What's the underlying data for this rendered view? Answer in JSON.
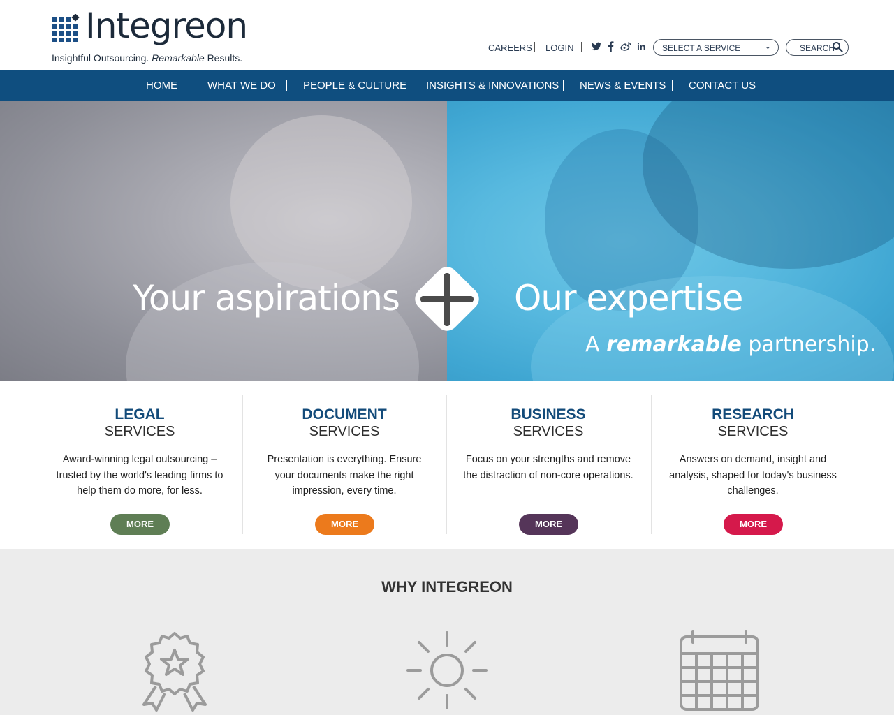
{
  "brand": {
    "name": "Integreon",
    "tagline_start": "Insightful Outsourcing.",
    "tagline_italic": "Remarkable",
    "tagline_end": "Results."
  },
  "utility": {
    "careers": "CAREERS",
    "login": "LOGIN",
    "social_icons": [
      "twitter-icon",
      "facebook-icon",
      "weibo-icon",
      "linkedin-icon"
    ],
    "select_service": "SELECT A SERVICE",
    "search": "SEARCH"
  },
  "nav": {
    "items": [
      "HOME",
      "WHAT WE DO",
      "PEOPLE & CULTURE",
      "INSIGHTS & INNOVATIONS",
      "NEWS & EVENTS",
      "CONTACT US"
    ]
  },
  "hero": {
    "left_heading": "Your aspirations",
    "right_heading": "Our expertise",
    "sub_start": "A",
    "sub_emphasis": "remarkable",
    "sub_end": "partnership."
  },
  "services": [
    {
      "title": "LEGAL",
      "subtitle": "SERVICES",
      "description": "Award-winning legal outsourcing – trusted by the world's leading firms to help them do more, for less.",
      "button": "MORE",
      "color": "#5f7e55"
    },
    {
      "title": "DOCUMENT",
      "subtitle": "SERVICES",
      "description": "Presentation is everything. Ensure your documents make the right impression, every time.",
      "button": "MORE",
      "color": "#ec7a1c"
    },
    {
      "title": "BUSINESS",
      "subtitle": "SERVICES",
      "description": "Focus on your strengths and remove the distraction of non-core operations.",
      "button": "MORE",
      "color": "#553559"
    },
    {
      "title": "RESEARCH",
      "subtitle": "SERVICES",
      "description": "Answers on demand, insight and analysis, shaped for today's business challenges.",
      "button": "MORE",
      "color": "#d5194b"
    }
  ],
  "why": {
    "title": "WHY INTEGREON",
    "icons": [
      "award-ribbon-icon",
      "sun-icon",
      "calendar-icon"
    ]
  },
  "colors": {
    "nav_bg": "#0f4e7f",
    "brand_blue": "#134b7a",
    "why_bg": "#ececec"
  }
}
